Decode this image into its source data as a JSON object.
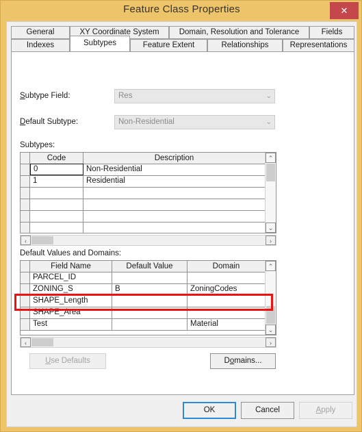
{
  "window": {
    "title": "Feature Class Properties",
    "close_label": "✕",
    "titlebar_color": "#edc46a",
    "close_color": "#c4474b"
  },
  "tabs": {
    "row1": [
      {
        "label": "General",
        "active": false
      },
      {
        "label": "XY Coordinate System",
        "active": false
      },
      {
        "label": "Domain, Resolution and Tolerance",
        "active": false
      },
      {
        "label": "Fields",
        "active": false
      }
    ],
    "row2": [
      {
        "label": "Indexes",
        "active": false
      },
      {
        "label": "Subtypes",
        "active": true
      },
      {
        "label": "Feature Extent",
        "active": false
      },
      {
        "label": "Relationships",
        "active": false
      },
      {
        "label": "Representations",
        "active": false
      }
    ]
  },
  "form": {
    "subtype_field": {
      "label_pre": "",
      "label_accel": "S",
      "label_post": "ubtype Field:",
      "value": "Res",
      "disabled": true,
      "arrow": "⌄"
    },
    "default_subtype": {
      "label_pre": "",
      "label_accel": "D",
      "label_post": "efault Subtype:",
      "value": "Non-Residential",
      "disabled": true,
      "arrow": "⌄"
    }
  },
  "subtypes_grid": {
    "label": "Subtypes:",
    "columns": [
      "Code",
      "Description"
    ],
    "rows": [
      {
        "code": "0",
        "description": "Non-Residential",
        "selected": true
      },
      {
        "code": "1",
        "description": "Residential",
        "selected": false
      },
      {
        "code": "",
        "description": "",
        "selected": false
      },
      {
        "code": "",
        "description": "",
        "selected": false
      },
      {
        "code": "",
        "description": "",
        "selected": false
      },
      {
        "code": "",
        "description": "",
        "selected": false
      }
    ],
    "scroll_up": "⌃",
    "scroll_down": "⌄",
    "scroll_left": "‹",
    "scroll_right": "›"
  },
  "defaults_grid": {
    "label": "Default Values and Domains:",
    "columns": [
      "Field Name",
      "Default Value",
      "Domain"
    ],
    "rows": [
      {
        "field_name": "PARCEL_ID",
        "default_value": "",
        "domain": "",
        "highlighted": false
      },
      {
        "field_name": "ZONING_S",
        "default_value": "B",
        "domain": "ZoningCodes",
        "highlighted": false
      },
      {
        "field_name": "SHAPE_Length",
        "default_value": "",
        "domain": "",
        "highlighted": false
      },
      {
        "field_name": "SHAPE_Area",
        "default_value": "",
        "domain": "",
        "highlighted": false
      },
      {
        "field_name": "Test",
        "default_value": "",
        "domain": "Material",
        "highlighted": true
      }
    ],
    "scroll_up": "⌃",
    "scroll_down": "⌄",
    "scroll_left": "‹",
    "scroll_right": "›",
    "highlight_color": "#ee1111"
  },
  "actions": {
    "use_defaults": {
      "pre": "",
      "accel": "U",
      "post": "se Defaults",
      "disabled": true
    },
    "domains": {
      "pre": "D",
      "accel": "o",
      "post": "mains...",
      "disabled": false
    }
  },
  "footer": {
    "ok": {
      "label": "OK",
      "disabled": false,
      "default": true
    },
    "cancel": {
      "label": "Cancel",
      "disabled": false,
      "default": false
    },
    "apply": {
      "pre": "",
      "accel": "A",
      "post": "pply",
      "disabled": true
    }
  }
}
